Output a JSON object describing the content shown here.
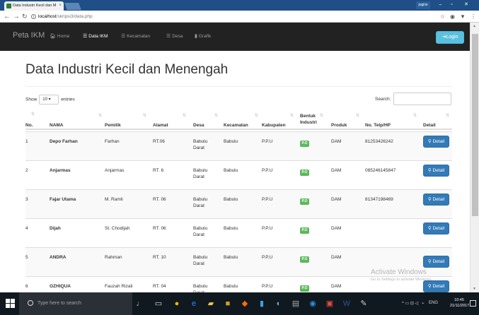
{
  "browser": {
    "tab_title": "Data Industri Kecil dan M",
    "user": "jogiris",
    "url_host": "localhost",
    "url_path": "/skripsi3/data.php",
    "win_min": "–",
    "win_max": "▫",
    "win_close": "✕"
  },
  "nav": {
    "brand": "Peta IKM",
    "items": [
      {
        "label": "Home",
        "icon": "home-icon"
      },
      {
        "label": "Data IKM",
        "icon": "list-icon"
      },
      {
        "label": "Kecamatan",
        "icon": "list-icon"
      },
      {
        "label": "Desa",
        "icon": "list-icon"
      },
      {
        "label": "Grafik",
        "icon": "bar-chart-icon"
      }
    ],
    "login": "Login"
  },
  "page": {
    "title": "Data Industri Kecil dan Menengah",
    "show_label": "Show",
    "show_value": "10",
    "entries_label": "entries",
    "search_label": "Search:"
  },
  "table": {
    "headers": [
      "No.",
      "NAMA",
      "Pemilik",
      "Alamat",
      "Desa",
      "Kecamatan",
      "Kabupaten",
      "Bentuk Industri",
      "Produk",
      "No. Telp/HP",
      "Detail"
    ],
    "rows": [
      {
        "no": "1",
        "nama": "Depo Farhan",
        "pemilik": "Farhan",
        "alamat": "RT.06",
        "desa": "Babulu Darat",
        "kecamatan": "Babulu",
        "kabupaten": "P.P.U",
        "bentuk": "P.O",
        "produk": "DAM",
        "telp": "81253426242",
        "detail": "Detail"
      },
      {
        "no": "2",
        "nama": "Anjarmas",
        "pemilik": "Anjarmas",
        "alamat": "RT. 6",
        "desa": "Babulu Darat",
        "kecamatan": "Babulu",
        "kabupaten": "P.P.U",
        "bentuk": "P.O",
        "produk": "DAM",
        "telp": "085246145847",
        "detail": "Detail"
      },
      {
        "no": "3",
        "nama": "Fajar Utama",
        "pemilik": "M. Ramli",
        "alamat": "RT. 06",
        "desa": "Babulu Darat",
        "kecamatan": "Babulu",
        "kabupaten": "P.P.U",
        "bentuk": "P.O",
        "produk": "DAM",
        "telp": "81347198469",
        "detail": "Detail"
      },
      {
        "no": "4",
        "nama": "Dijah",
        "pemilik": "St. Chodijah",
        "alamat": "RT. 06",
        "desa": "Babulu Darat",
        "kecamatan": "Babulu",
        "kabupaten": "P.P.U",
        "bentuk": "P.O",
        "produk": "DAM",
        "telp": "",
        "detail": "Detail"
      },
      {
        "no": "5",
        "nama": "ANDRA",
        "pemilik": "Rahman",
        "alamat": "RT. 10",
        "desa": "Babulu Darat",
        "kecamatan": "Babulu",
        "kabupaten": "P.P.U",
        "bentuk": "P.O",
        "produk": "DAM",
        "telp": "",
        "detail": "Detail"
      },
      {
        "no": "6",
        "nama": "OZHIQUA",
        "pemilik": "Fauzah Rizali",
        "alamat": "RT. 04",
        "desa": "Babulu Darat",
        "kecamatan": "Babulu",
        "kabupaten": "P.P.U",
        "bentuk": "P.O",
        "produk": "DAM",
        "telp": "",
        "detail": "Detail"
      }
    ]
  },
  "watermark": {
    "line1": "Activate Windows",
    "line2": "Go to Settings to activate Windows."
  },
  "taskbar": {
    "search_placeholder": "Type here to search",
    "lang": "ENG",
    "time": "10:45",
    "date": "21/11/2017"
  },
  "colors": {
    "navbar": "#222222",
    "primary": "#337ab7",
    "success": "#5cb85c",
    "info": "#5bc0de"
  }
}
